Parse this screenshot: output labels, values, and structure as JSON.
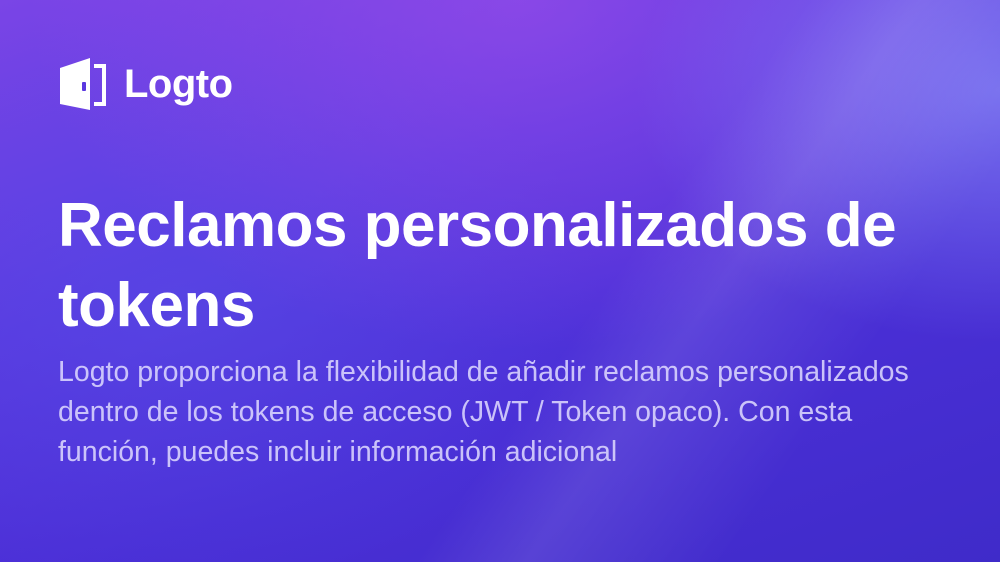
{
  "brand": {
    "name": "Logto",
    "icon": "logto-door-icon"
  },
  "article": {
    "title": "Reclamos personalizados de tokens",
    "description": "Logto proporciona la flexibilidad de añadir reclamos personalizados dentro de los tokens de acceso (JWT / Token opaco). Con esta función, puedes incluir información adicional"
  },
  "colors": {
    "background_top": "#7a45e6",
    "background_bottom": "#3f2bc9",
    "text_primary": "#ffffff",
    "text_secondary": "#e1dcff"
  }
}
